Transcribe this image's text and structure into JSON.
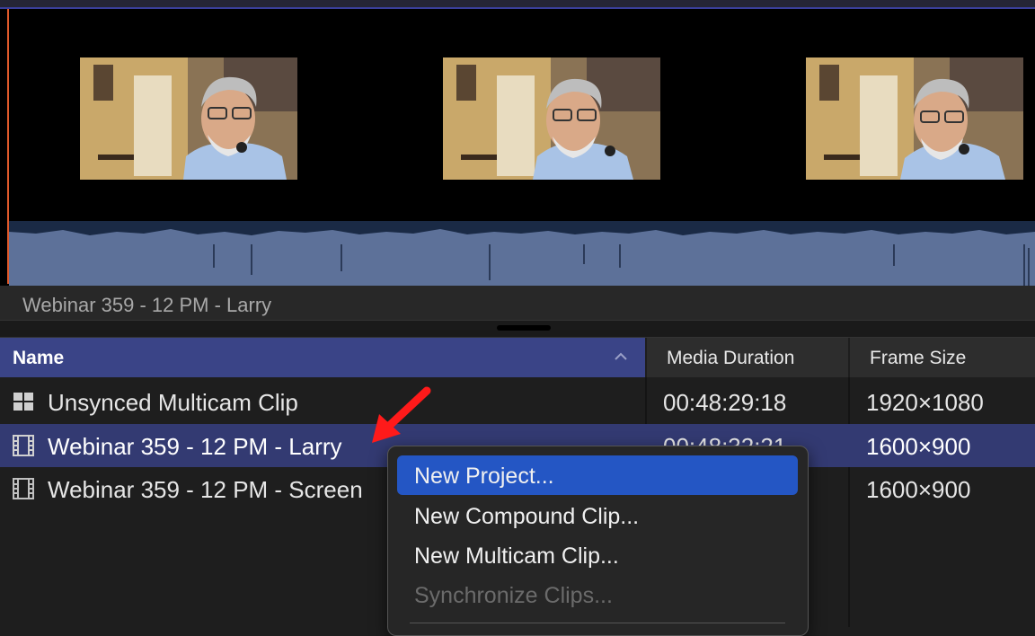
{
  "clip_title": "Webinar 359 - 12 PM - Larry",
  "columns": {
    "name": "Name",
    "media_duration": "Media Duration",
    "frame_size": "Frame Size"
  },
  "rows": [
    {
      "name": "Unsynced Multicam Clip",
      "duration": "00:48:29:18",
      "frame_size": "1920×1080",
      "icon": "multicam-icon",
      "selected": false
    },
    {
      "name": "Webinar 359 - 12 PM - Larry",
      "duration": "00:48:32:21",
      "frame_size": "1600×900",
      "icon": "film-icon",
      "selected": true
    },
    {
      "name": "Webinar 359 - 12 PM - Screen",
      "duration": "",
      "frame_size": "1600×900",
      "icon": "film-icon",
      "selected": false
    }
  ],
  "context_menu": {
    "items": [
      {
        "label": "New Project...",
        "state": "highlighted"
      },
      {
        "label": "New Compound Clip...",
        "state": "enabled"
      },
      {
        "label": "New Multicam Clip...",
        "state": "enabled"
      },
      {
        "label": "Synchronize Clips...",
        "state": "disabled"
      }
    ]
  },
  "colors": {
    "header_selected": "#3a4487",
    "row_selected": "#333a72",
    "menu_highlight": "#2456c4",
    "playhead": "#e05a2b",
    "waveform": "#5d7199",
    "annotation_arrow": "#ff1a1a"
  }
}
